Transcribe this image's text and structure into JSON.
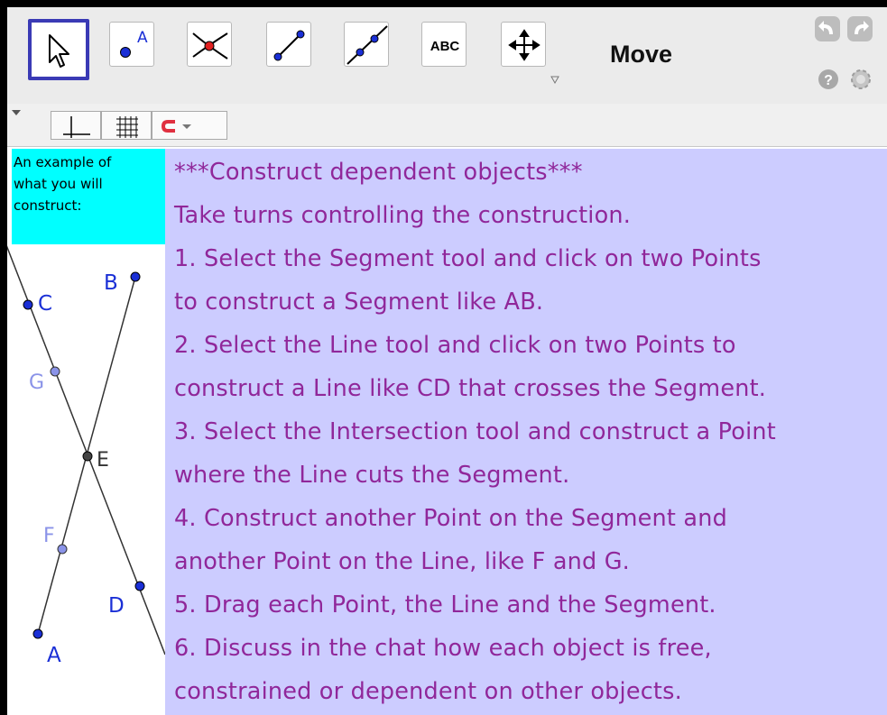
{
  "toolbar": {
    "tools": [
      {
        "name": "move-tool",
        "icon": "arrow-cursor-icon"
      },
      {
        "name": "point-tool",
        "icon": "point-icon",
        "icon_label": "A"
      },
      {
        "name": "intersect-tool",
        "icon": "intersect-icon"
      },
      {
        "name": "segment-tool",
        "icon": "segment-icon"
      },
      {
        "name": "line-tool",
        "icon": "line-icon"
      },
      {
        "name": "text-tool",
        "icon": "text-icon",
        "icon_label": "ABC"
      },
      {
        "name": "move-graphics-tool",
        "icon": "move-graphics-icon"
      }
    ],
    "mode_label": "Move",
    "accent_color": "#3a3ab5"
  },
  "stylebar": {
    "buttons": [
      "show-axes-icon",
      "show-grid-icon",
      "point-capturing-icon"
    ],
    "magnet_color": "#e03040"
  },
  "left_panel": {
    "label_lines": [
      "An example of",
      "what you will",
      "construct:"
    ],
    "label_bg": "#00ffff",
    "points": [
      {
        "label": "A",
        "color": "#1a2fd6"
      },
      {
        "label": "B",
        "color": "#1a2fd6"
      },
      {
        "label": "C",
        "color": "#1a2fd6"
      },
      {
        "label": "D",
        "color": "#1a2fd6"
      },
      {
        "label": "E",
        "color": "#333333"
      },
      {
        "label": "F",
        "color": "#8a93e8"
      },
      {
        "label": "G",
        "color": "#8a93e8"
      }
    ]
  },
  "instructions": {
    "lines": [
      "***Construct dependent objects***",
      "Take turns controlling the construction.",
      "1. Select the Segment tool and click on two Points",
      "to construct a Segment like AB.",
      "2. Select the Line tool and click on two Points to",
      "construct a Line like CD that crosses the Segment.",
      "3. Select the Intersection tool and construct a Point",
      "where the Line cuts the Segment.",
      "4. Construct another Point on the Segment and",
      "another Point on the Line, like F and G.",
      "5. Drag each Point, the Line and the Segment.",
      "6. Discuss in the chat how each object is free,",
      "constrained or dependent on other objects."
    ],
    "text_color": "#90279a",
    "bg_color": "#ccccff"
  }
}
